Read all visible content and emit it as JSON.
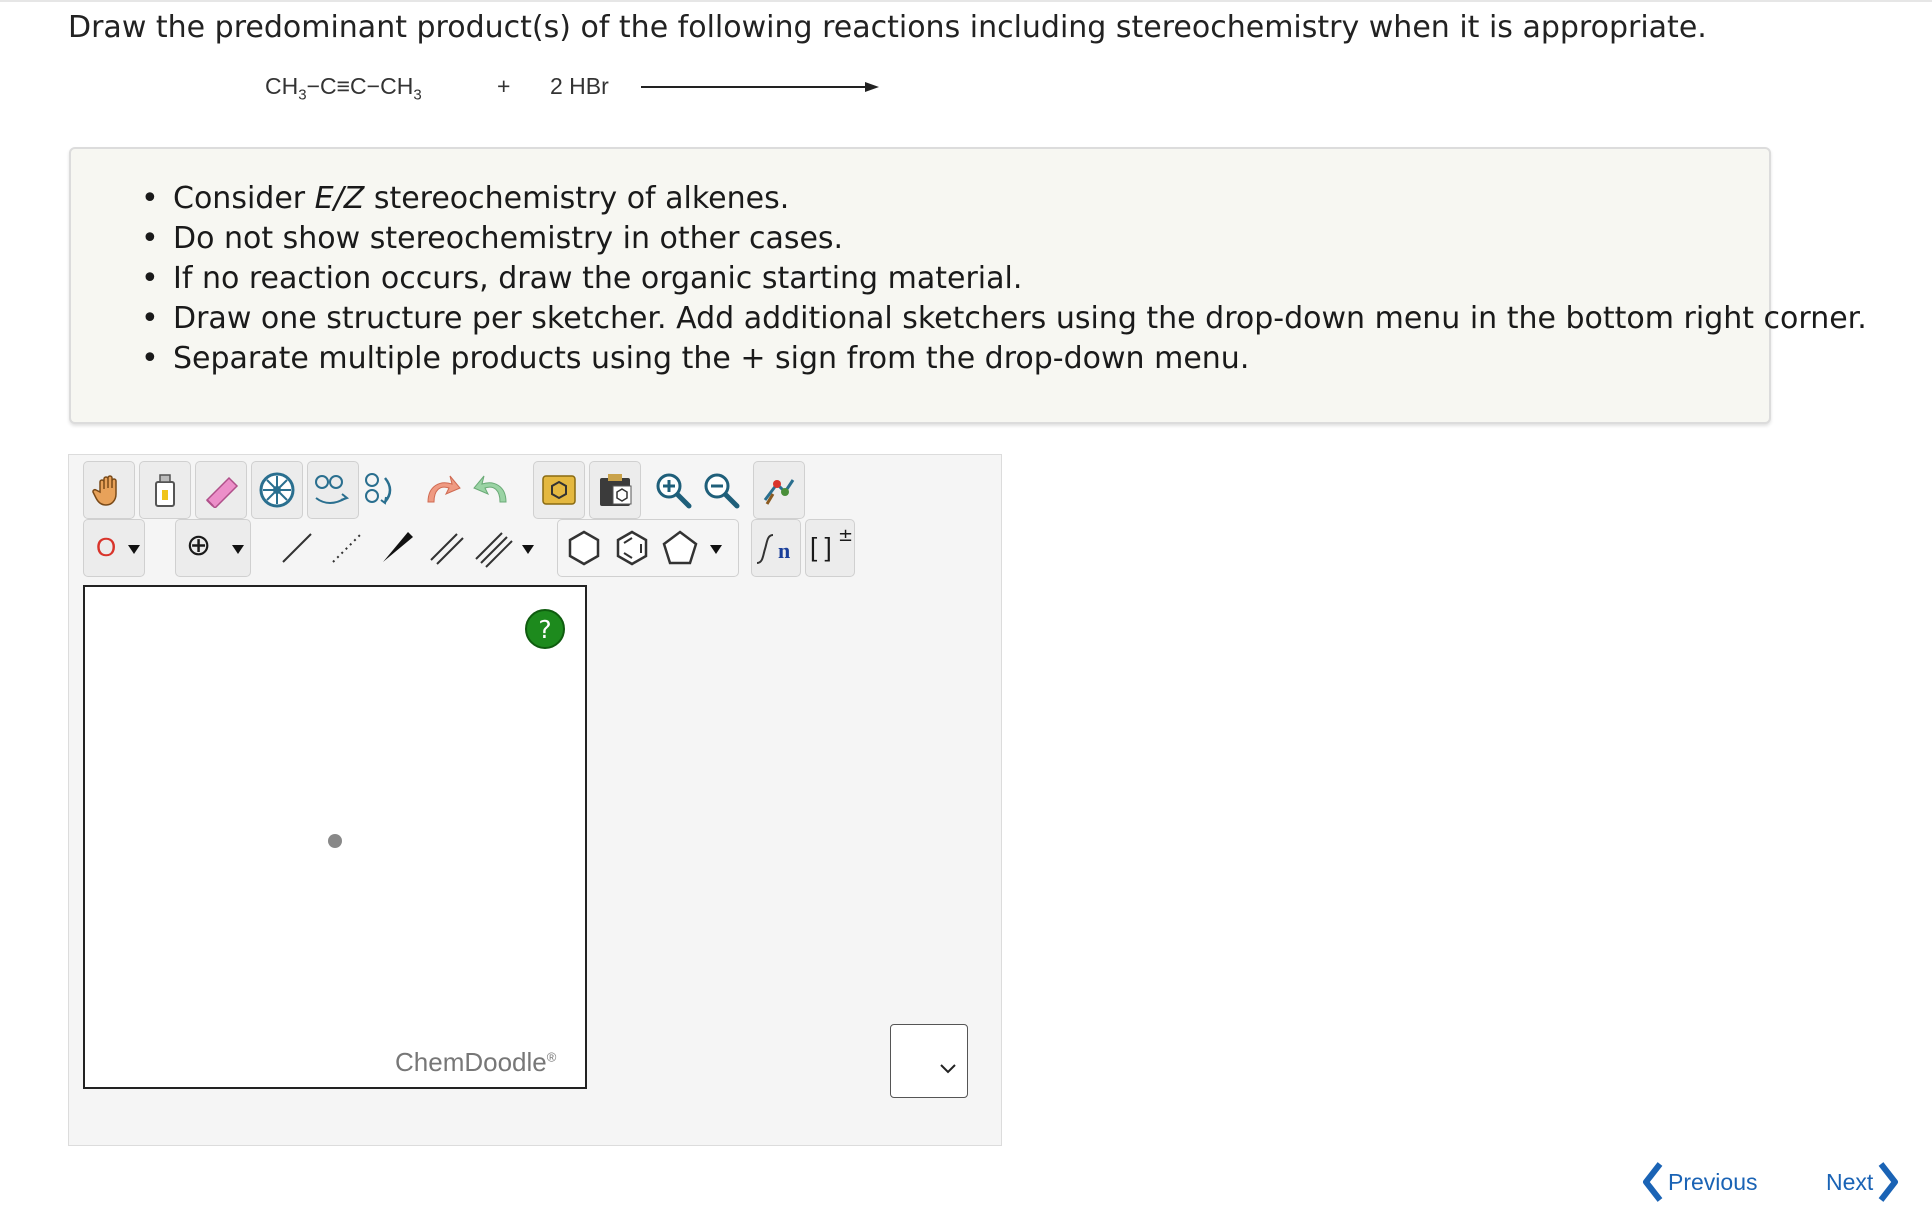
{
  "question": {
    "text": "Draw the predominant product(s) of the following reactions including stereochemistry when it is appropriate."
  },
  "reaction": {
    "reactant_parts": [
      "CH",
      "3",
      "−C≡C−CH",
      "3"
    ],
    "plus": "+",
    "reagent": "2 HBr"
  },
  "instructions": {
    "items": [
      {
        "pre": "Consider ",
        "em": "E/Z",
        "post": " stereochemistry of alkenes."
      },
      {
        "pre": "Do not show stereochemistry in other cases.",
        "em": "",
        "post": ""
      },
      {
        "pre": "If no reaction occurs, draw the organic starting material.",
        "em": "",
        "post": ""
      },
      {
        "pre": "Draw one structure per sketcher. Add additional sketchers using the drop-down menu in the bottom right corner.",
        "em": "",
        "post": ""
      },
      {
        "pre": "Separate multiple products using the + sign from the drop-down menu.",
        "em": "",
        "post": ""
      }
    ]
  },
  "toolbar": {
    "row1_icons": [
      "hand-icon",
      "erase-all-icon",
      "eraser-icon",
      "center-icon",
      "flip-icon",
      "rotate-icon",
      "undo-icon",
      "redo-icon",
      "templates-icon",
      "clipboard-icon",
      "zoom-in-icon",
      "zoom-out-icon",
      "cleanup-icon"
    ],
    "row2_icons": [
      "atom-label-icon",
      "charge-icon",
      "single-bond-icon",
      "dashed-bond-icon",
      "wedge-bond-icon",
      "double-bond-icon",
      "triple-bond-icon",
      "hexagon-ring-icon",
      "benzene-ring-icon",
      "pentagon-ring-icon",
      "repeat-unit-icon",
      "bracket-charge-icon"
    ],
    "atom_label": "O",
    "charge_symbol": "⊕",
    "repeat_label": "n",
    "bracket_label": "[ ]",
    "bracket_sup": "±"
  },
  "sketcher": {
    "help_label": "?",
    "brand": "ChemDoodle",
    "brand_mark": "®"
  },
  "nav": {
    "previous": "Previous",
    "next": "Next"
  },
  "colors": {
    "accent": "#1a63b5",
    "help": "#1d8a1d",
    "atom_label": "#d9342b"
  }
}
